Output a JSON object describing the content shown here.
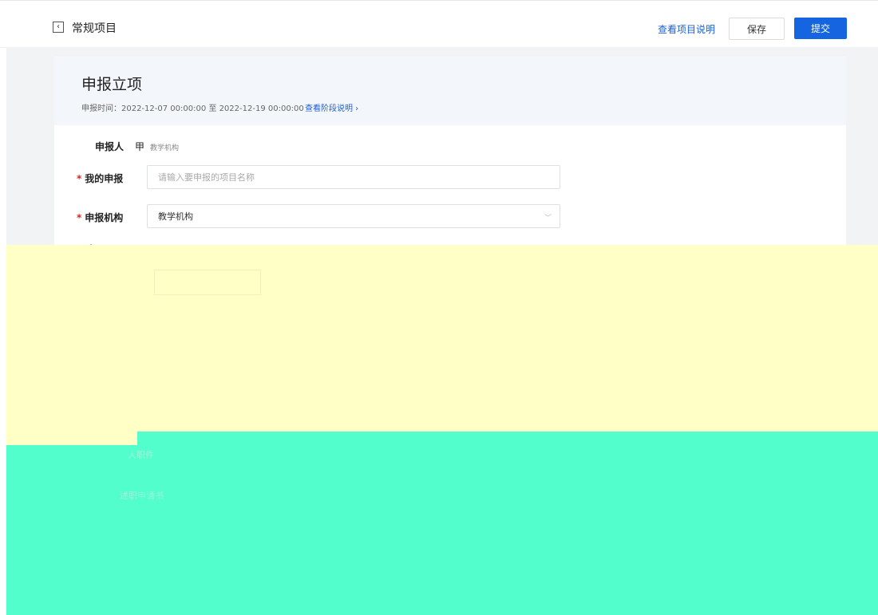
{
  "header": {
    "back_glyph": "‹",
    "title": "常规项目",
    "link_desc": "查看项目说明",
    "save_label": "保存",
    "submit_label": "提交"
  },
  "stage": {
    "title": "申报立项",
    "time_text": "申报时间：2022-12-07 00:00:00 至 2022-12-19 00:00:00",
    "link_label": "查看阶段说明 ›"
  },
  "form": {
    "applicant_label": "申报人",
    "applicant_name": "甲",
    "applicant_org": "教学机构",
    "my_app_label": "我的申报",
    "my_app_placeholder": "请输入要申报的项目名称",
    "org_label": "申报机构",
    "org_value": "教学机构",
    "partial_label": "选",
    "req_mark": "*"
  },
  "occluded": {
    "teal_text_1": "人职件",
    "teal_text_2": "述职申请书"
  },
  "colors": {
    "accent": "#1565e0",
    "link": "#1a5fd6",
    "required": "#e02020",
    "overlay_yellow": "#ffffc6",
    "overlay_teal": "#52ffcc"
  }
}
